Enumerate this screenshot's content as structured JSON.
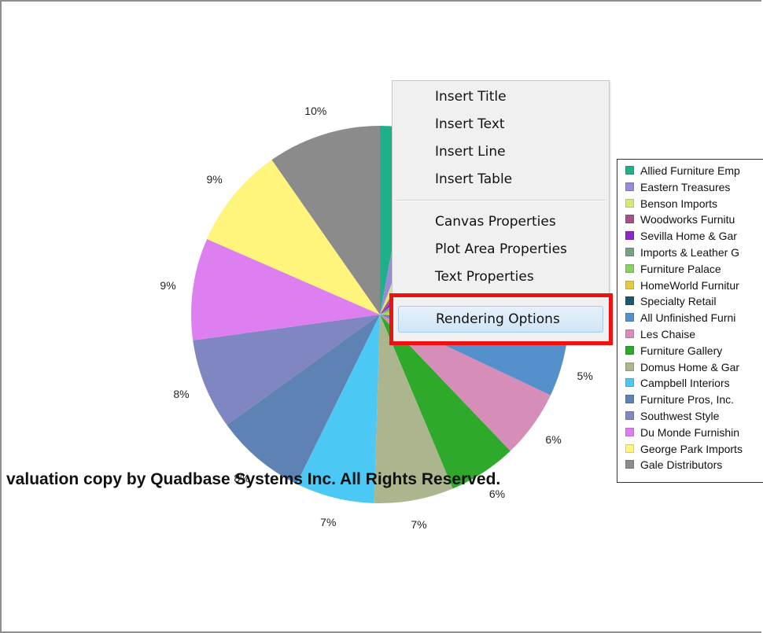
{
  "chart_data": {
    "type": "pie",
    "categories": [
      "Allied Furniture Emp",
      "Eastern Treasures",
      "Benson Imports",
      "Woodworks Furnitu",
      "Sevilla Home & Gar",
      "Imports & Leather G",
      "Furniture Palace",
      "HomeWorld Furnitur",
      "Specialty Retail",
      "All Unfinished Furni",
      "Les Chaise",
      "Furniture Gallery",
      "Domus Home & Gar",
      "Campbell Interiors",
      "Furniture Pros, Inc.",
      "Southwest Style",
      "Du Monde Furnishin",
      "George Park Imports",
      "Gale Distributors"
    ],
    "values": [
      3,
      3,
      3,
      3,
      3,
      4,
      4,
      4,
      1,
      5,
      6,
      6,
      7,
      7,
      8,
      8,
      9,
      9,
      10
    ],
    "colors": [
      "#1fb08a",
      "#9b8ad8",
      "#d8e878",
      "#a8508a",
      "#8a28c8",
      "#7a9e86",
      "#8ccf64",
      "#e2cc3c",
      "#1a5a6a",
      "#5590cc",
      "#d68eb8",
      "#2fa92b",
      "#abb68e",
      "#4cc8f4",
      "#5e82b4",
      "#8086c2",
      "#dd7ff0",
      "#fff47c",
      "#8b8b8b"
    ],
    "slice_labels": {
      "9": "5%",
      "10": "6%",
      "11": "6%",
      "12": "7%",
      "13": "7%",
      "14": "8%",
      "15": "8%",
      "16": "9%",
      "17": "9%",
      "18": "10%"
    },
    "legend_position": "right"
  },
  "watermark": "valuation copy by Quadbase Systems Inc. All Rights Reserved.",
  "context_menu": {
    "items": [
      {
        "label": "Insert Title"
      },
      {
        "label": "Insert Text"
      },
      {
        "label": "Insert Line"
      },
      {
        "label": "Insert Table"
      },
      {
        "label": "Canvas Properties"
      },
      {
        "label": "Plot Area Properties"
      },
      {
        "label": "Text Properties"
      },
      {
        "label": "Rendering Options"
      }
    ],
    "highlighted": "Rendering Options",
    "highlight_color": "#ee1111"
  }
}
